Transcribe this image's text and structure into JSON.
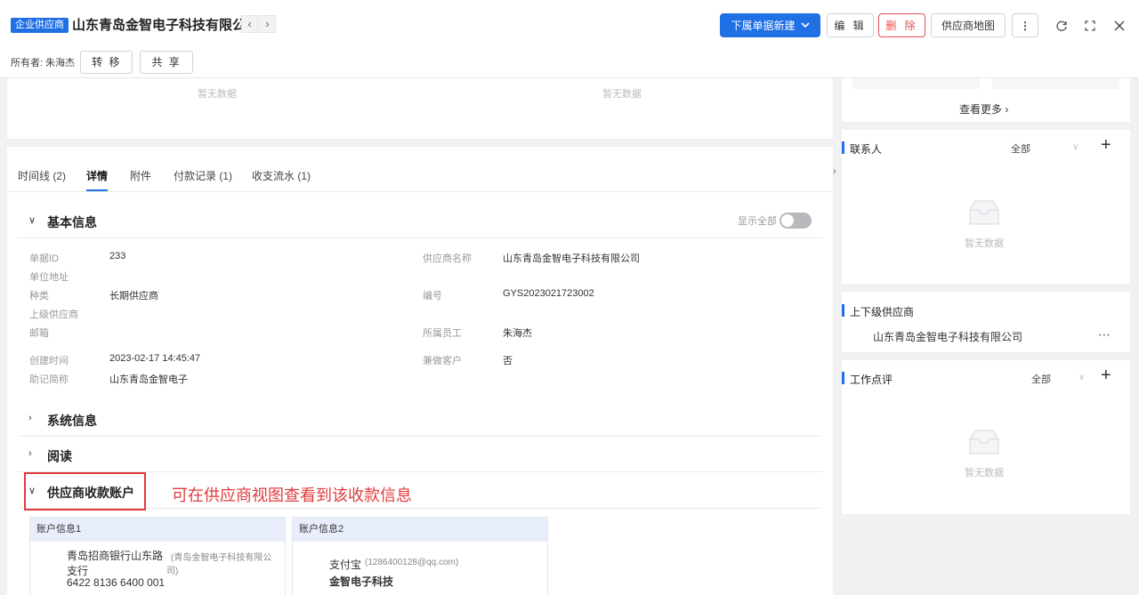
{
  "header": {
    "type_badge": "企业供应商",
    "company_name": "山东青岛金智电子科技有限公司",
    "prev_icon": "chevron-left",
    "next_icon": "chevron-right",
    "owner_label": "所有者: 朱海杰",
    "transfer_label": "转 移",
    "share_label": "共 享",
    "new_doc_label": "下属单据新建",
    "edit_label": "编 辑",
    "delete_label": "删 除",
    "map_label": "供应商地图",
    "more_label": "⋮",
    "accent_color": "#1f6fe5",
    "danger_color": "#e34d4d"
  },
  "top_card": {
    "empty_left": "暂无数据",
    "empty_right": "暂无数据"
  },
  "tabs": [
    {
      "label": "时间线 (2)"
    },
    {
      "label": "详情"
    },
    {
      "label": "附件"
    },
    {
      "label": "付款记录 (1)"
    },
    {
      "label": "收支流水 (1)"
    }
  ],
  "basic_info": {
    "title": "基本信息",
    "show_all_label": "显示全部",
    "show_all_on": false,
    "fields": {
      "doc_id_label": "单据ID",
      "doc_id_value": "233",
      "supplier_name_label": "供应商名称",
      "supplier_name_value": "山东青岛金智电子科技有限公司",
      "address_label": "单位地址",
      "category_label": "种类",
      "category_value": "长期供应商",
      "code_label": "编号",
      "code_value": "GYS2023021723002",
      "parent_label": "上级供应商",
      "email_label": "邮箱",
      "employee_label": "所属员工",
      "employee_value": "朱海杰",
      "created_label": "创建时间",
      "created_value": "2023-02-17 14:45:47",
      "customer_label": "兼做客户",
      "customer_value": "否",
      "mnemonic_label": "助记简称",
      "mnemonic_value": "山东青岛金智电子"
    }
  },
  "sections": {
    "system": "系统信息",
    "read": "阅读",
    "accounts": "供应商收款账户"
  },
  "annotation": "可在供应商视图查看到该收款信息",
  "accounts": [
    {
      "title": "账户信息1",
      "bank_line1": "青岛招商银行山东路",
      "bank_line2": "支行",
      "holder_line1": "(青岛金智电子科技有限公",
      "holder_line2": "司)",
      "number": "6422 8136 6400 001"
    },
    {
      "title": "账户信息2",
      "bank_line1": "支付宝",
      "holder_line1": "(1286400128@qq.com)",
      "number": "金智电子科技"
    }
  ],
  "right_panel": {
    "see_more": "查看更多",
    "contacts": {
      "title": "联系人",
      "filter": "全部",
      "empty": "暂无数据"
    },
    "suppliers": {
      "title": "上下级供应商",
      "item": "山东青岛金智电子科技有限公司"
    },
    "reviews": {
      "title": "工作点评",
      "filter": "全部",
      "empty": "暂无数据"
    }
  }
}
